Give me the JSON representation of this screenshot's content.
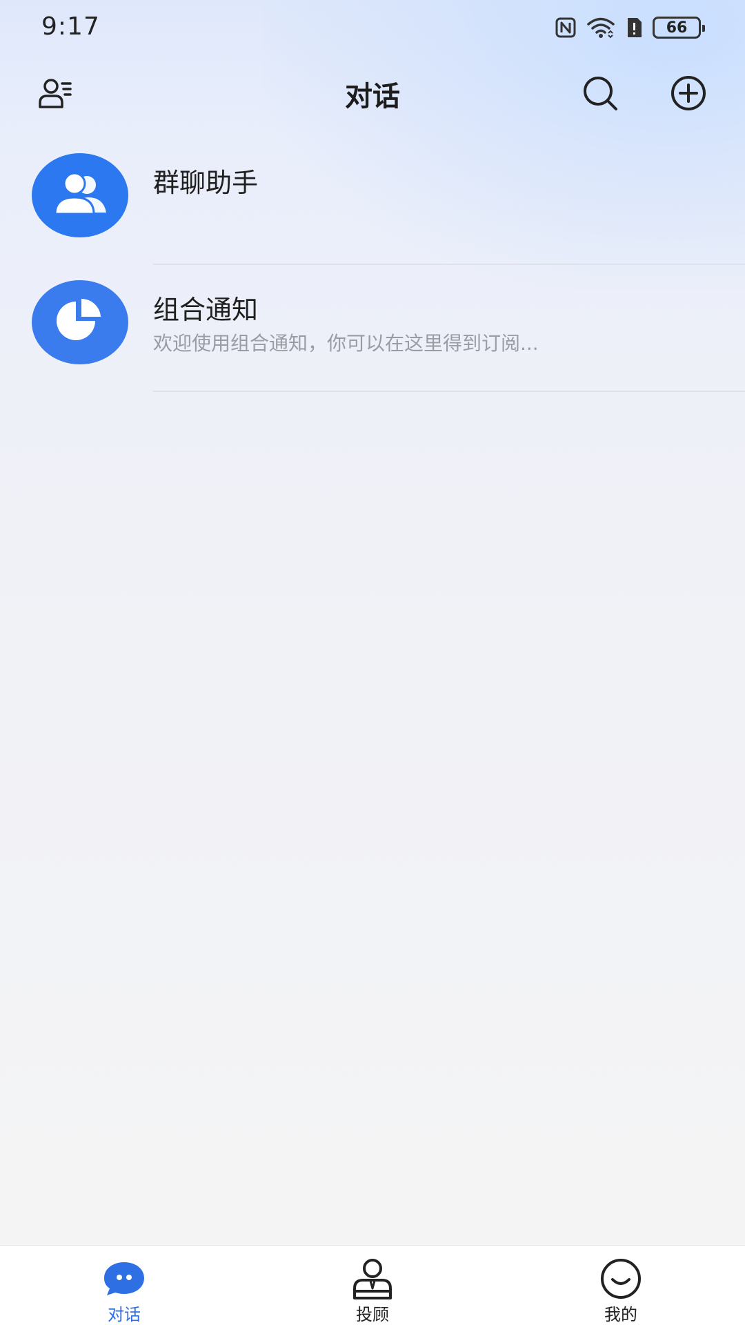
{
  "status_bar": {
    "time": "9:17",
    "battery_level": "66",
    "icons": [
      "nfc-icon",
      "wifi-icon",
      "alert-icon",
      "battery-icon"
    ]
  },
  "header": {
    "title": "对话",
    "left_icon": "contacts-icon",
    "right_icons": [
      "search-icon",
      "add-circle-icon"
    ]
  },
  "conversations": [
    {
      "title": "群聊助手",
      "preview": "",
      "icon": "group-users-icon"
    },
    {
      "title": "组合通知",
      "preview": "欢迎使用组合通知，你可以在这里得到订阅...",
      "icon": "pie-chart-icon"
    }
  ],
  "bottom_nav": {
    "items": [
      {
        "label": "对话",
        "icon": "chat-bubble-icon",
        "active": true
      },
      {
        "label": "投顾",
        "icon": "advisor-icon",
        "active": false
      },
      {
        "label": "我的",
        "icon": "smile-icon",
        "active": false
      }
    ]
  },
  "colors": {
    "accent": "#2f6fe4",
    "avatar_blue": "#2b78f0",
    "preview_gray": "#9a9ca3"
  }
}
